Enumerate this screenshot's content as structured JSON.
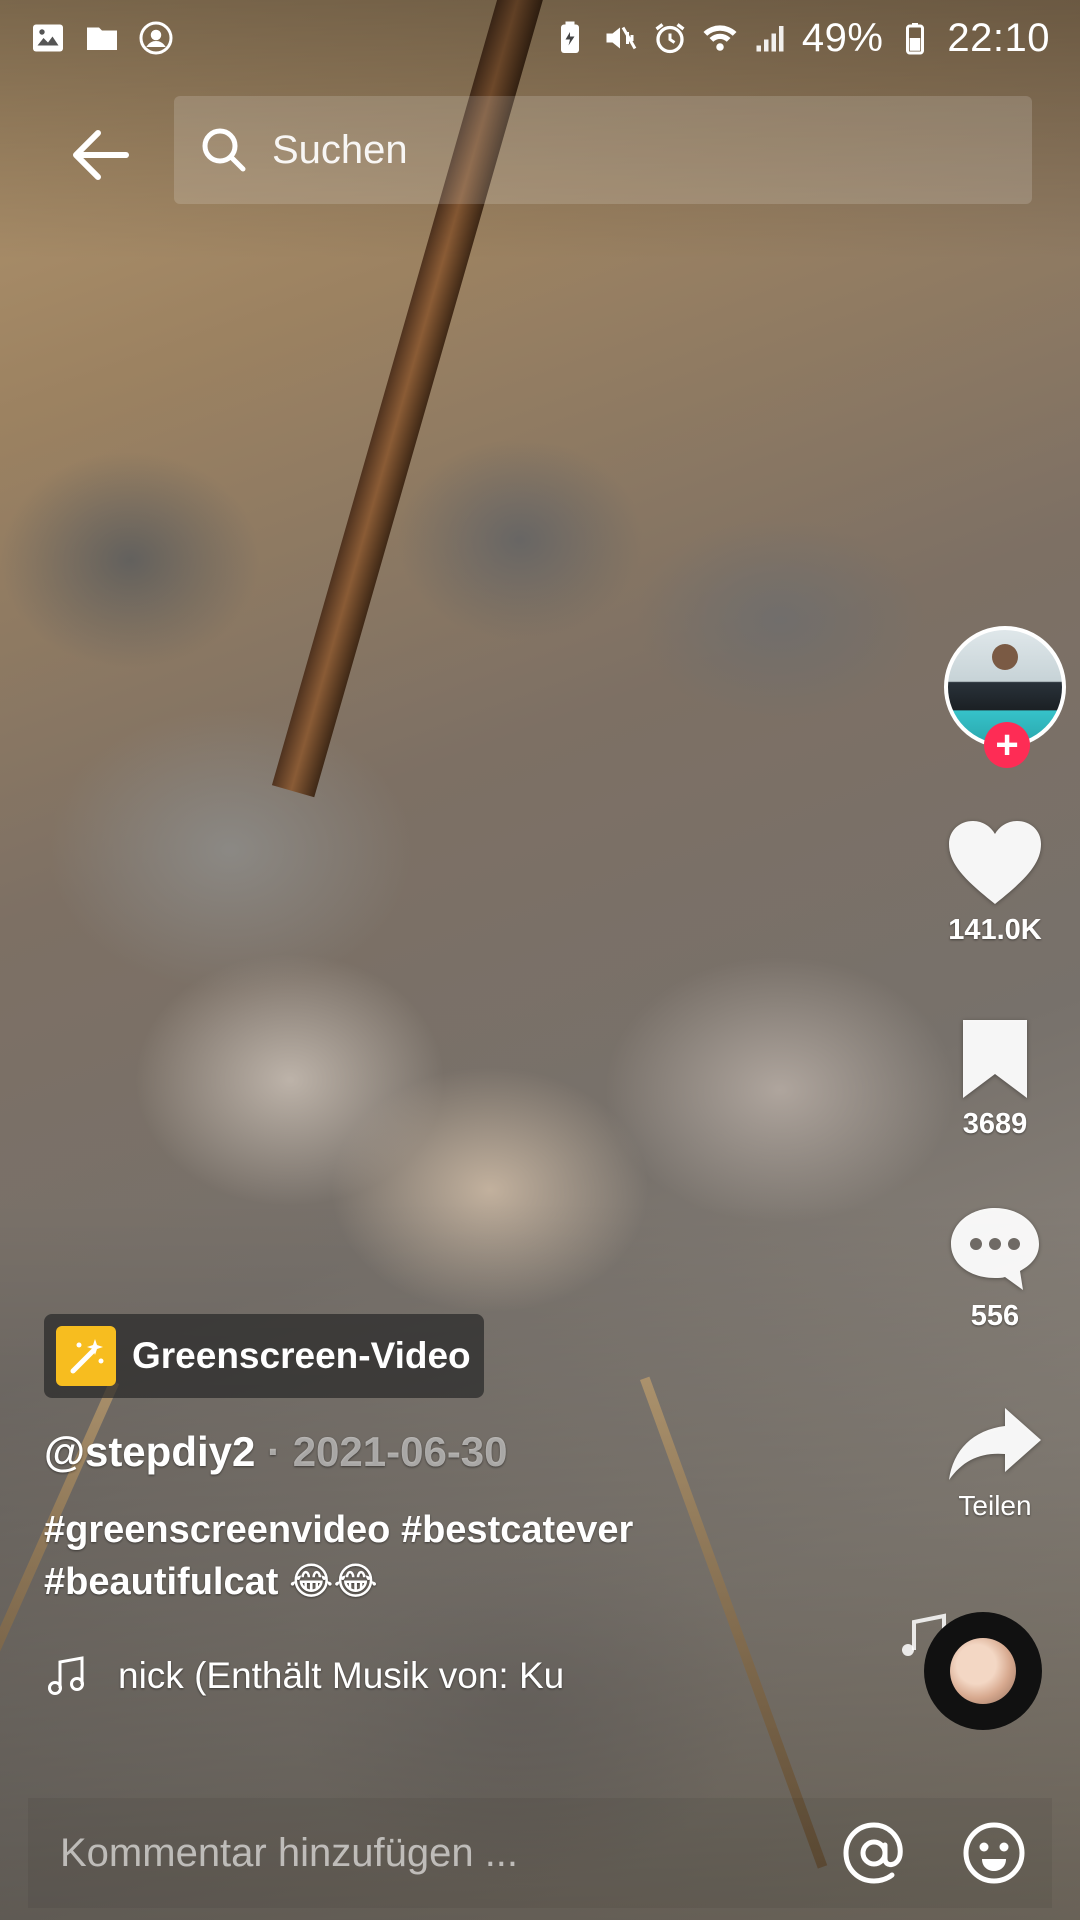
{
  "status_bar": {
    "left_icons": [
      "gallery-icon",
      "folder-icon",
      "account-icon"
    ],
    "right_icons": [
      "battery-saver-icon",
      "mute-vibrate-icon",
      "alarm-icon",
      "wifi-icon",
      "signal-icon",
      "battery-icon"
    ],
    "battery_percent": "49%",
    "time": "22:10"
  },
  "header": {
    "back_icon": "arrow-left-icon",
    "search_placeholder": "Suchen"
  },
  "rail": {
    "like_count": "141.0K",
    "bookmark_count": "3689",
    "comment_count": "556",
    "share_label": "Teilen",
    "follow_symbol": "+"
  },
  "video": {
    "effect_label": "Greenscreen-Video",
    "author": "@stepdiy2",
    "separator": " · ",
    "date": "2021-06-30",
    "caption": "#greenscreenvideo #bestcatever #beautifulcat 😂😂",
    "music": "nick (Enthält Musik von: Ku"
  },
  "comment_bar": {
    "placeholder": "Kommentar hinzufügen ..."
  },
  "colors": {
    "accent_red": "#fe2c55",
    "greenscreen_yellow": "#f7bd1f"
  }
}
